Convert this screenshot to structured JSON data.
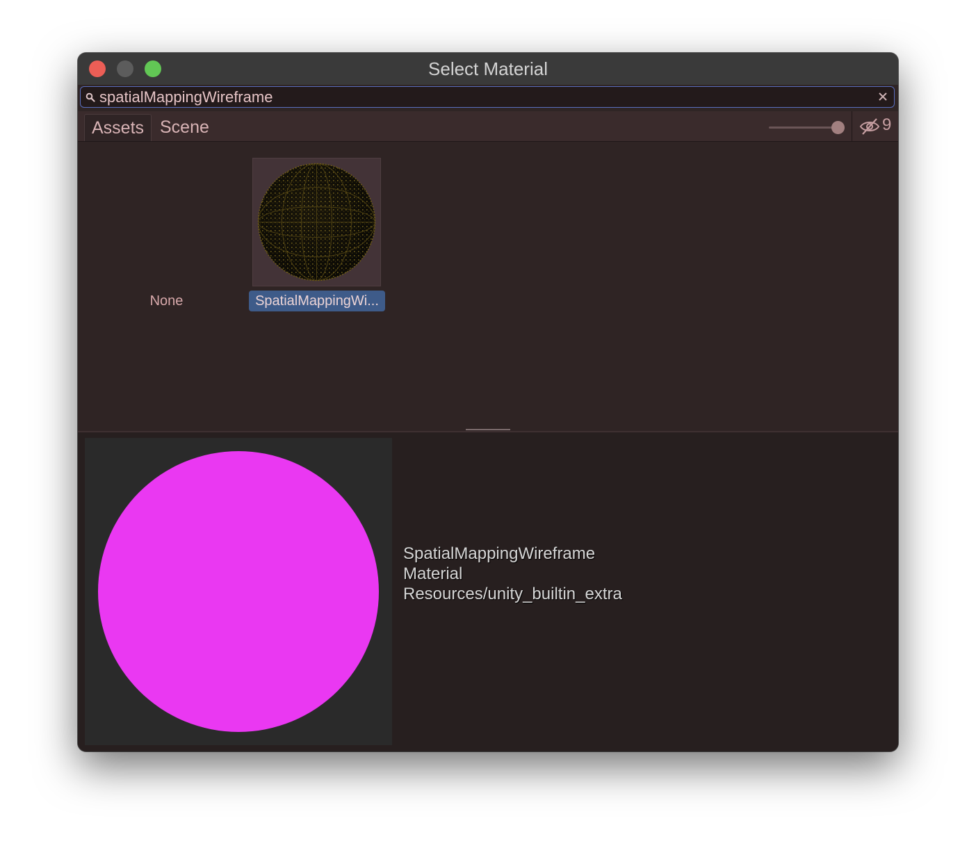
{
  "window": {
    "title": "Select Material",
    "controls": {
      "close_color": "#ec5e56",
      "minimize_color": "#5c5c5c",
      "maximize_color": "#62c755"
    }
  },
  "search": {
    "value": "spatialMappingWireframe",
    "icon": "search-icon",
    "clear_icon": "close-icon"
  },
  "tabs": [
    {
      "label": "Assets",
      "active": true
    },
    {
      "label": "Scene",
      "active": false
    }
  ],
  "toolbar": {
    "zoom_slider_level": 1.0,
    "hidden_icon": "eye-slash-icon",
    "hidden_count": "9"
  },
  "grid": {
    "none_label": "None",
    "items": [
      {
        "label": "SpatialMappingWi...",
        "selected": true,
        "thumbnail": "wireframe-sphere"
      }
    ]
  },
  "preview": {
    "sphere_color": "#ea38f2",
    "name": "SpatialMappingWireframe",
    "type": "Material",
    "path": "Resources/unity_builtin_extra"
  }
}
